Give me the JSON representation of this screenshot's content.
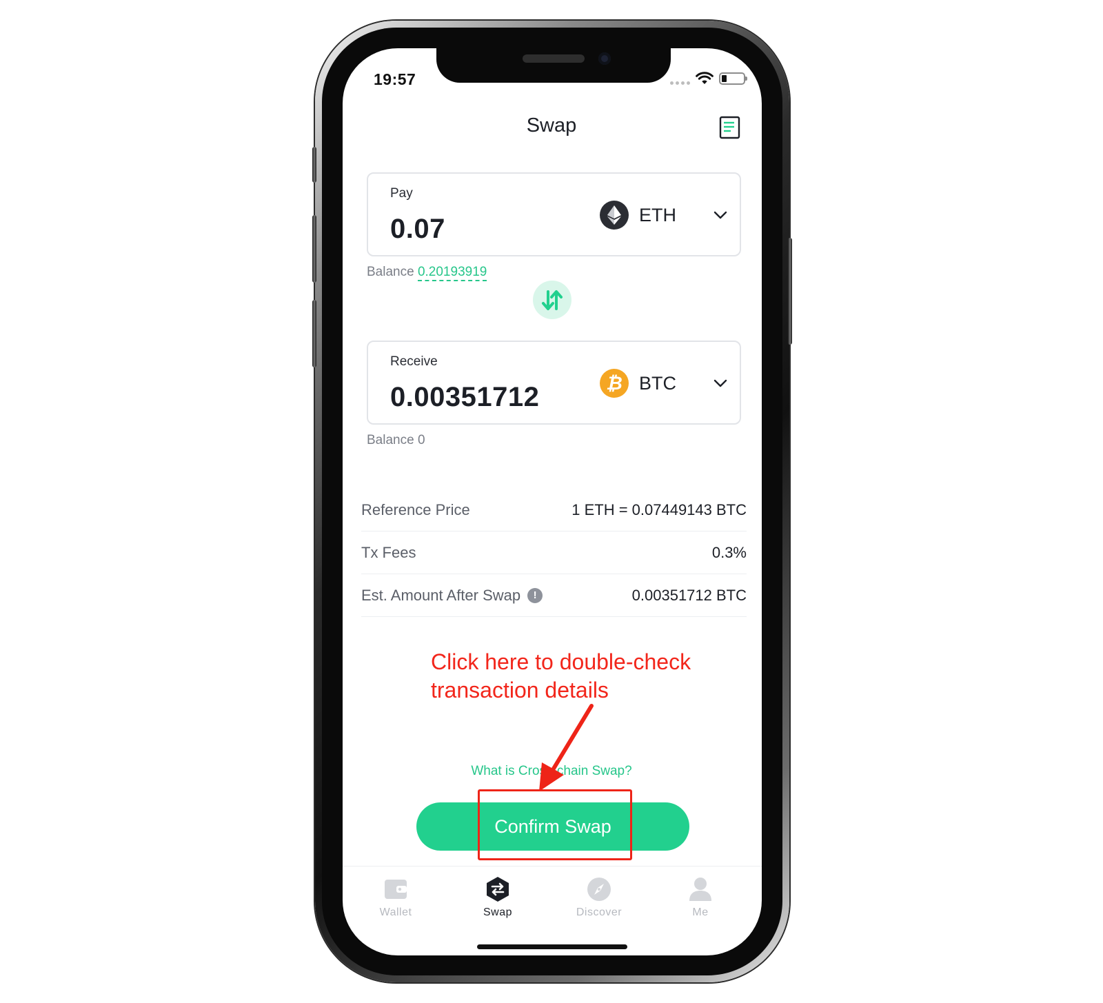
{
  "status_bar": {
    "time": "19:57"
  },
  "header": {
    "title": "Swap",
    "history_icon": "document-list-icon"
  },
  "pay": {
    "label": "Pay",
    "amount": "0.07",
    "token": "ETH",
    "token_color": "#2b2d33",
    "balance_label": "Balance",
    "balance_value": "0.20193919"
  },
  "receive": {
    "label": "Receive",
    "amount": "0.00351712",
    "token": "BTC",
    "token_color": "#f5a623",
    "balance_label": "Balance",
    "balance_value": "0"
  },
  "details": [
    {
      "label": "Reference Price",
      "value": "1 ETH = 0.07449143 BTC"
    },
    {
      "label": "Tx Fees",
      "value": "0.3%"
    },
    {
      "label": "Est. Amount After Swap",
      "value": "0.00351712 BTC"
    }
  ],
  "annotation": {
    "line1": "Click here to double-check",
    "line2": "transaction details"
  },
  "help_link": "What is Cross-chain Swap?",
  "confirm_button": "Confirm Swap",
  "tabs": [
    {
      "label": "Wallet",
      "icon": "wallet-icon",
      "active": false
    },
    {
      "label": "Swap",
      "icon": "swap-icon",
      "active": true
    },
    {
      "label": "Discover",
      "icon": "compass-icon",
      "active": false
    },
    {
      "label": "Me",
      "icon": "user-icon",
      "active": false
    }
  ],
  "colors": {
    "accent": "#22d08e",
    "annotation": "#f2261b"
  }
}
